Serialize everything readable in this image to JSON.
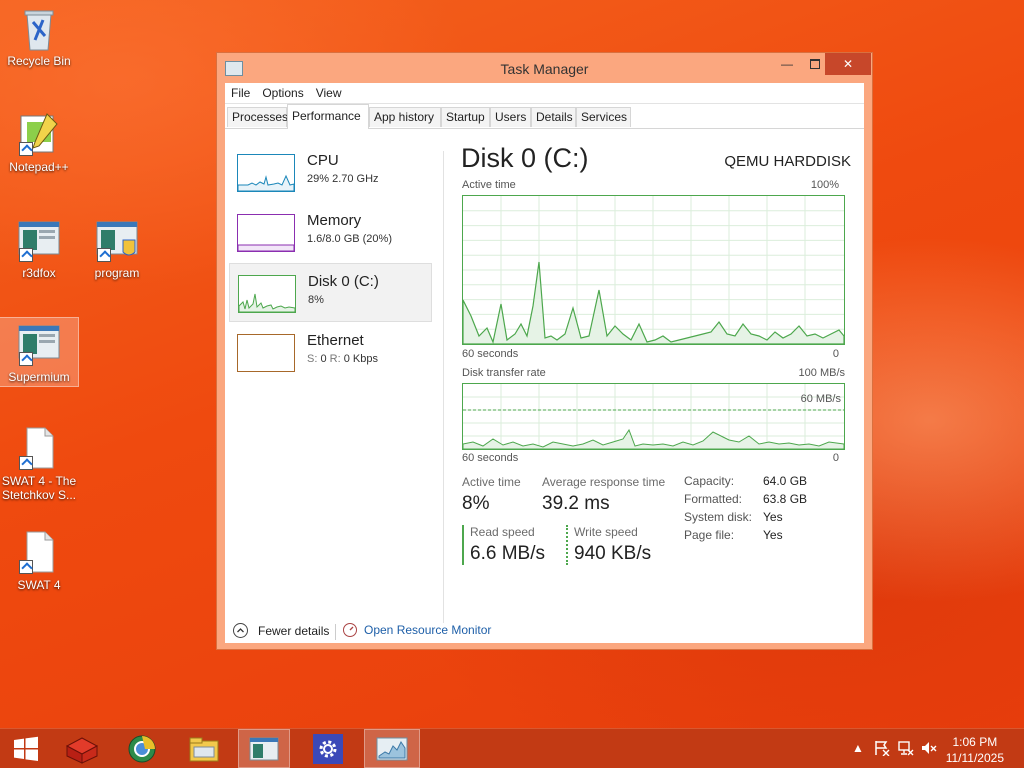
{
  "desktop": {
    "icons": [
      {
        "label": "Recycle Bin"
      },
      {
        "label": "Notepad++"
      },
      {
        "label": "r3dfox"
      },
      {
        "label": "program"
      },
      {
        "label": "Supermium"
      },
      {
        "label": "SWAT 4 - The Stetchkov S..."
      },
      {
        "label": "SWAT 4"
      }
    ]
  },
  "window": {
    "title": "Task Manager",
    "menu": [
      "File",
      "Options",
      "View"
    ],
    "tabs": [
      "Processes",
      "Performance",
      "App history",
      "Startup",
      "Users",
      "Details",
      "Services"
    ],
    "active_tab": "Performance"
  },
  "perf_list": [
    {
      "name": "CPU",
      "sub": "29%  2.70 GHz",
      "color": "#1b87b9"
    },
    {
      "name": "Memory",
      "sub": "1.6/8.0 GB (20%)",
      "color": "#8b2eb0"
    },
    {
      "name": "Disk 0 (C:)",
      "sub": "8%",
      "color": "#4da74d"
    },
    {
      "name": "Ethernet",
      "sub_s": "S:",
      "sub_s_val": "0",
      "sub_r": "R:",
      "sub_r_val": "0 Kbps",
      "color": "#a7682a"
    }
  ],
  "detail": {
    "title": "Disk 0 (C:)",
    "model": "QEMU HARDDISK",
    "active_time_label": "Active time",
    "active_time_max": "100%",
    "seconds_label": "60 seconds",
    "zero": "0",
    "transfer_label": "Disk transfer rate",
    "transfer_max": "100 MB/s",
    "transfer_mid": "60 MB/s",
    "stats": {
      "active_time_label": "Active time",
      "active_time": "8%",
      "response_label": "Average response time",
      "response": "39.2 ms",
      "read_label": "Read speed",
      "read": "6.6 MB/s",
      "write_label": "Write speed",
      "write": "940 KB/s"
    },
    "info": [
      {
        "label": "Capacity:",
        "value": "64.0 GB"
      },
      {
        "label": "Formatted:",
        "value": "63.8 GB"
      },
      {
        "label": "System disk:",
        "value": "Yes"
      },
      {
        "label": "Page file:",
        "value": "Yes"
      }
    ]
  },
  "footer": {
    "fewer_details": "Fewer details",
    "open_resource_monitor": "Open Resource Monitor"
  },
  "taskbar": {
    "time": "1:06 PM",
    "date": "11/11/2025"
  }
}
